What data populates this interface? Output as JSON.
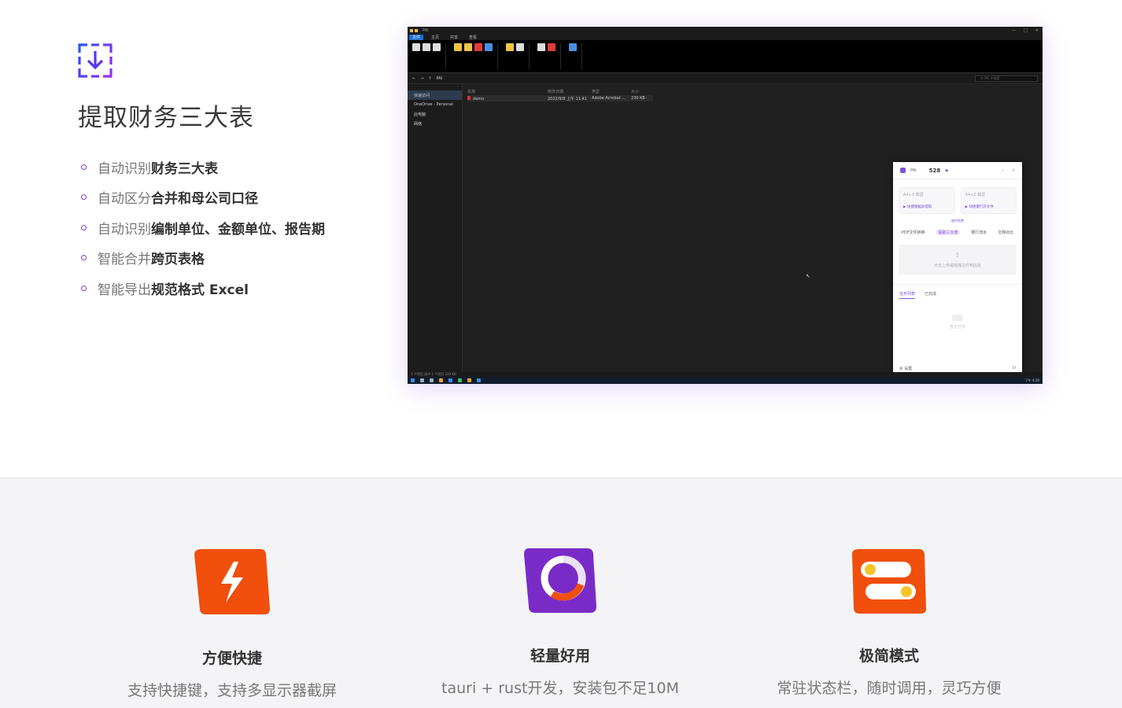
{
  "hero": {
    "title": "提取财务三大表",
    "features": [
      {
        "prefix": "自动识别",
        "bold": "财务三大表"
      },
      {
        "prefix": "自动区分",
        "bold": "合并和母公司口径"
      },
      {
        "prefix": "自动识别",
        "bold": "编制单位、金额单位、报告期"
      },
      {
        "prefix": "智能合并",
        "bold": "跨页表格"
      },
      {
        "prefix": "智能导出",
        "bold": "规范格式 Excel"
      }
    ],
    "accent_color": "#7b3fe4"
  },
  "screenshot": {
    "window_title": "PAI",
    "menu_tabs": [
      "文件",
      "主页",
      "共享",
      "查看"
    ],
    "address_path": "PAI",
    "search_placeholder": "在 PAI 中搜索",
    "nav_items": [
      "快速访问",
      "OneDrive - Personal",
      "此电脑",
      "网络"
    ],
    "columns": [
      "名称",
      "修改日期",
      "类型",
      "大小"
    ],
    "file": {
      "name": "demo",
      "date": "2022/9/8 上午 11:41",
      "type": "Adobe Acrobat ...",
      "size": "230 KB"
    },
    "status_text": "1 个项目   选中 1 个项目 229 KB",
    "clock": "下午 4:20",
    "app": {
      "name": "PAI",
      "count": "528",
      "card_left": {
        "caption": "A4+X 截屏",
        "link": "▶ 快捷键截屏提取"
      },
      "card_right": {
        "caption": "A4+Z 截屏",
        "link": "▶ 快捷键打开文件"
      },
      "tabs": [
        "PDF文件转换",
        "提取三大表",
        "银行流水",
        "文档对比"
      ],
      "tab_badge": "限时免费",
      "drop_text": "点击上传或拖拽文件到此处",
      "task_tabs": [
        "任务列表",
        "已完成"
      ],
      "empty_text": "暂无任务",
      "settings_label": "设置"
    }
  },
  "cards": [
    {
      "title": "方便快捷",
      "desc": "支持快捷键，支持多显示器截屏",
      "icon": "lightning-icon",
      "color": "#f04f0c"
    },
    {
      "title": "轻量好用",
      "desc": "tauri + rust开发，安装包不足10M",
      "icon": "ring-icon",
      "color": "#7a2bc7"
    },
    {
      "title": "极简模式",
      "desc": "常驻状态栏，随时调用，灵巧方便",
      "icon": "toggle-icon",
      "color": "#f04f0c"
    }
  ]
}
